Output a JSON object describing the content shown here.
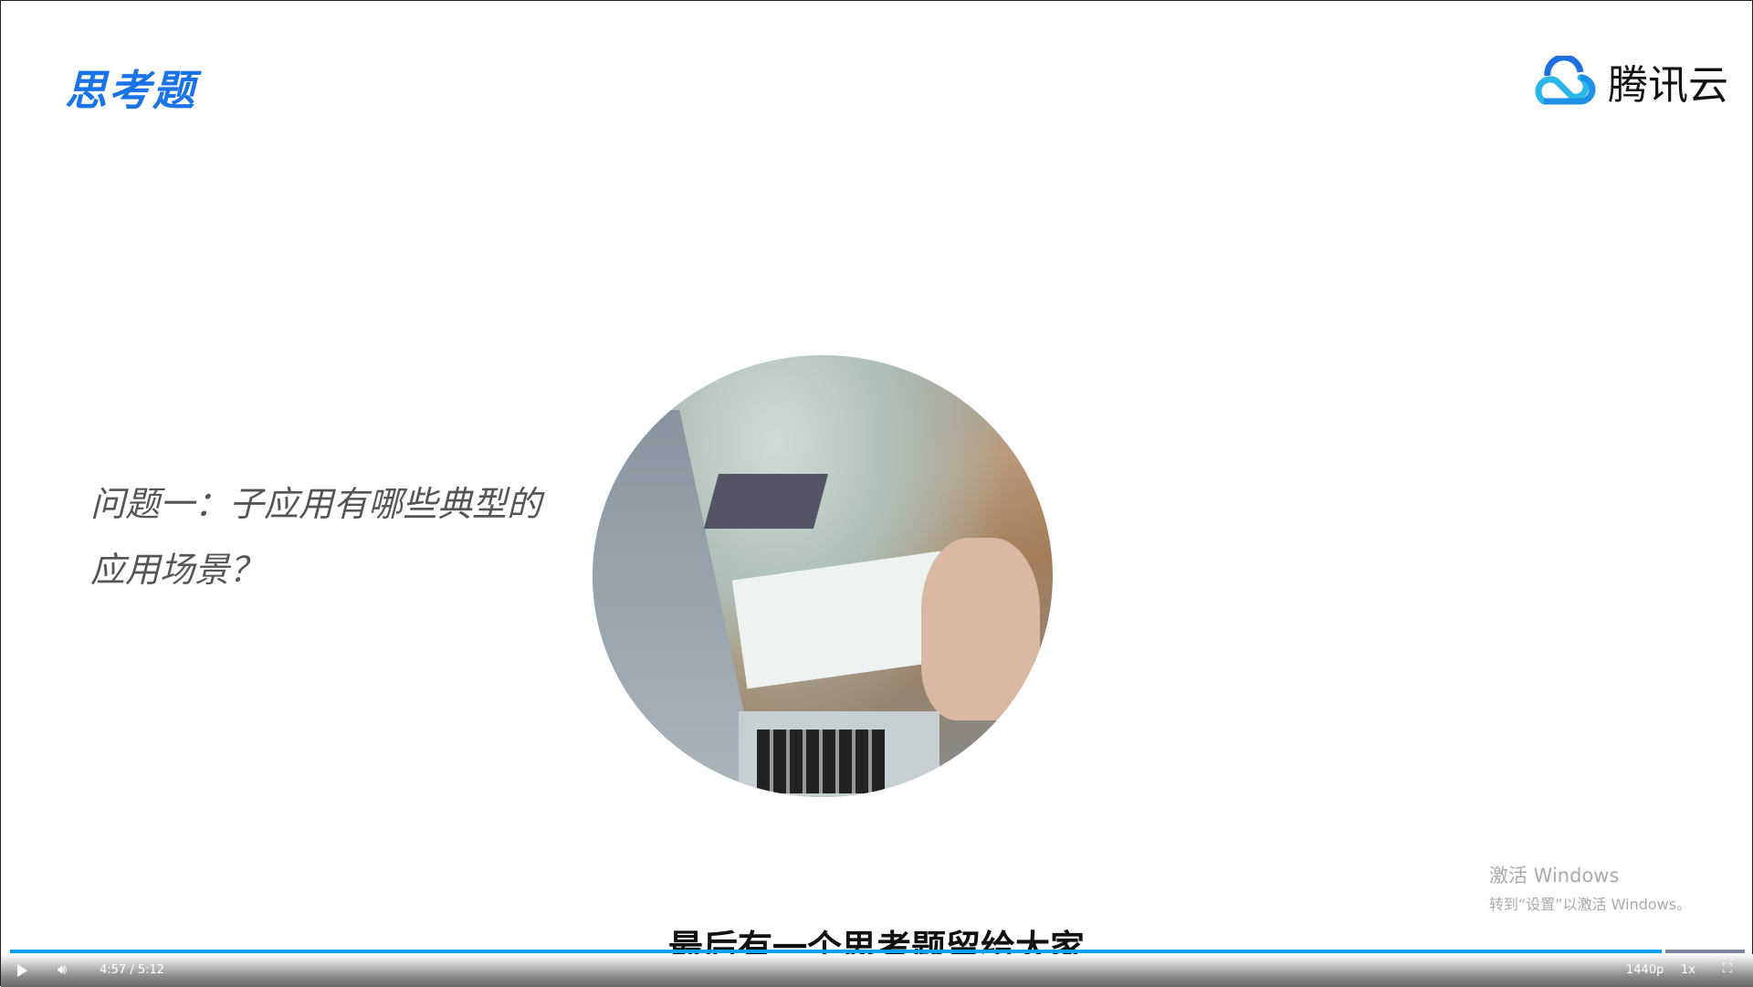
{
  "slide": {
    "title": "思考题",
    "brand": "腾讯云",
    "question_line1": "问题一：子应用有哪些典型的",
    "question_line2": "应用场景？"
  },
  "subtitle": "最后有一个思考题留给大家",
  "watermark": {
    "line1": "激活 Windows",
    "line2": "转到“设置”以激活 Windows。"
  },
  "player": {
    "time": "4:57 / 5:12",
    "progress_percent": 95.2,
    "quality": "1440p",
    "speed": "1x",
    "icons": [
      "play-icon",
      "volume-icon",
      "exit-fullscreen-icon"
    ],
    "accent": "#00a1f1"
  }
}
